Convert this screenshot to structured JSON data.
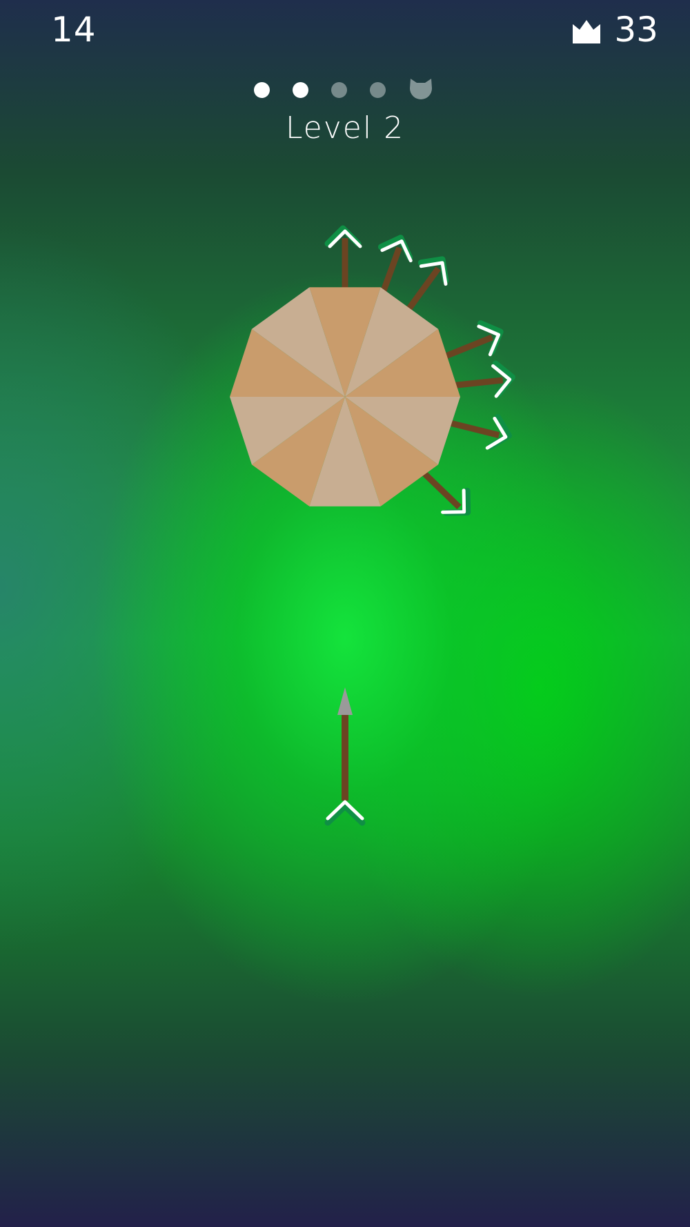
{
  "hud": {
    "score": "14",
    "best_score": "33",
    "crown_icon": "crown-icon"
  },
  "stages": {
    "completed": 2,
    "total": 5,
    "last_is_boss": true,
    "boss_icon": "cat-face-icon"
  },
  "level_label": "Level 2",
  "target": {
    "sides": 10,
    "colors": [
      "#c99c6c",
      "#c8ae92"
    ]
  },
  "arrows": {
    "stuck_count": 7,
    "shaft_color": "#6b4422",
    "fletching_color": "#ffffff",
    "fletching_shadow": "#0f8f45",
    "tip_color": "#9a9a9a"
  }
}
